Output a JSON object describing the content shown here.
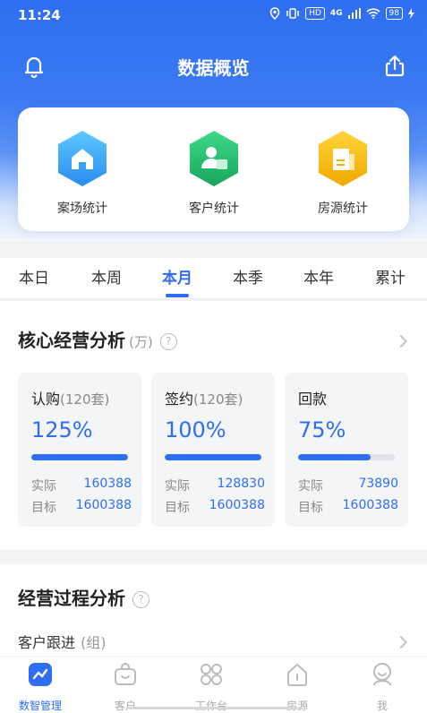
{
  "status": {
    "time": "11:24",
    "hd": "HD",
    "net": "4G",
    "battery": "98"
  },
  "header": {
    "title": "数据概览"
  },
  "quick": [
    {
      "label": "案场统计",
      "color": "#3aa0f4"
    },
    {
      "label": "客户统计",
      "color": "#23b766"
    },
    {
      "label": "房源统计",
      "color": "#f5b400"
    }
  ],
  "tabs": [
    "本日",
    "本周",
    "本月",
    "本季",
    "本年",
    "累计"
  ],
  "active_tab": "本月",
  "core": {
    "title": "核心经营分析",
    "unit": "(万)",
    "help": "?",
    "metrics": [
      {
        "name": "认购",
        "count": "(120套)",
        "percent": "125%",
        "progress": 1.0,
        "actual_label": "实际",
        "actual": "160388",
        "target_label": "目标",
        "target": "1600388"
      },
      {
        "name": "签约",
        "count": "(120套)",
        "percent": "100%",
        "progress": 1.0,
        "actual_label": "实际",
        "actual": "128830",
        "target_label": "目标",
        "target": "1600388"
      },
      {
        "name": "回款",
        "count": "",
        "percent": "75%",
        "progress": 0.75,
        "actual_label": "实际",
        "actual": "73890",
        "target_label": "目标",
        "target": "1600388"
      }
    ]
  },
  "process": {
    "title": "经营过程分析",
    "help": "?",
    "row_label": "客户跟进",
    "row_unit": "(组)"
  },
  "tabbar": [
    {
      "label": "数智管理",
      "icon": "chart-icon",
      "active": true
    },
    {
      "label": "客户",
      "icon": "customer-icon",
      "active": false
    },
    {
      "label": "工作台",
      "icon": "workbench-icon",
      "active": false
    },
    {
      "label": "房源",
      "icon": "house-icon",
      "active": false
    },
    {
      "label": "我",
      "icon": "me-icon",
      "active": false
    }
  ],
  "colors": {
    "primary": "#2f6ef0"
  }
}
